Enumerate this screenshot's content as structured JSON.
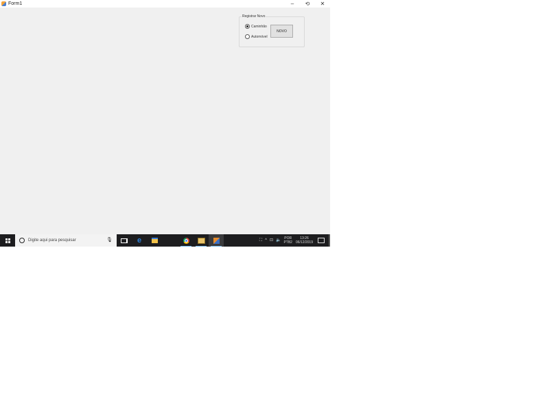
{
  "window": {
    "title": "Form1",
    "controls": {
      "minimize": "–",
      "maximize": "⟲",
      "close": "✕"
    }
  },
  "groupbox": {
    "title": "Registrar Novo",
    "radios": [
      {
        "label": "Caminhão",
        "checked": true
      },
      {
        "label": "Automóvel",
        "checked": false
      }
    ],
    "button_label": "NOVO"
  },
  "taskbar": {
    "search_placeholder": "Digite aqui para pesquisar",
    "mic": "🎙",
    "edge": "e",
    "tray": {
      "people": "⛶",
      "chevron": "^",
      "network": "⊡",
      "volume": "🔈",
      "lang_top": "POR",
      "lang_bottom": "PTB2",
      "time": "13:26",
      "date": "06/12/2019"
    }
  }
}
